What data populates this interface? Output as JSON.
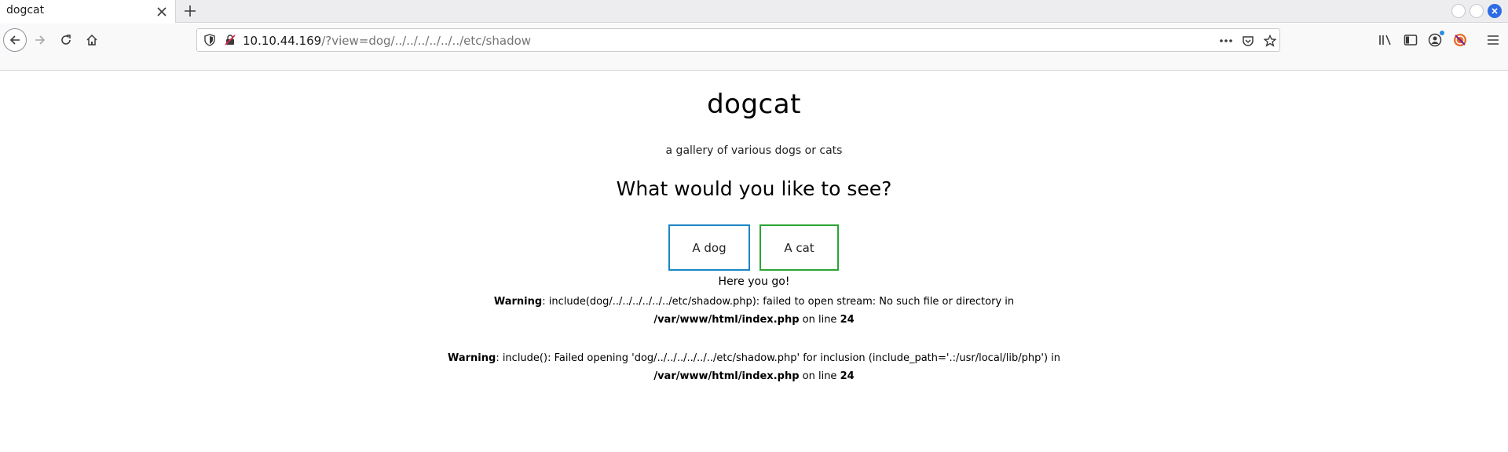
{
  "browser": {
    "tab_title": "dogcat",
    "url_host": "10.10.44.169",
    "url_path": "/?view=dog/../../../../../../etc/shadow"
  },
  "icons": {
    "tab_close": "close-icon",
    "new_tab": "plus-icon",
    "back": "arrow-left-icon",
    "forward": "arrow-right-icon",
    "reload": "reload-icon",
    "home": "home-icon",
    "tracking": "shield-icon",
    "insecure": "insecure-lock-icon",
    "page_actions": "more-icon",
    "pocket": "pocket-icon",
    "bookmark": "star-icon",
    "library": "library-icon",
    "sidebar": "sidebar-icon",
    "account": "account-icon",
    "extension": "extension-icon",
    "menu": "hamburger-icon"
  },
  "colors": {
    "dog_button_border": "#1b86c4",
    "cat_button_border": "#2aa536",
    "window_close": "#2d6ce3"
  },
  "page": {
    "title": "dogcat",
    "subtitle": "a gallery of various dogs or cats",
    "heading": "What would you like to see?",
    "dog_button": "A dog",
    "cat_button": "A cat",
    "result": "Here you go!",
    "warning1": {
      "label": "Warning",
      "text_a": ": include(dog/../../../../../../etc/shadow.php): failed to open stream: No such file or directory in ",
      "file": "/var/www/html/index.php",
      "text_b": " on line ",
      "line": "24"
    },
    "warning2": {
      "label": "Warning",
      "text_a": ": include(): Failed opening 'dog/../../../../../../etc/shadow.php' for inclusion (include_path='.:/usr/local/lib/php') in",
      "file": "/var/www/html/index.php",
      "text_b": " on line ",
      "line": "24"
    }
  }
}
